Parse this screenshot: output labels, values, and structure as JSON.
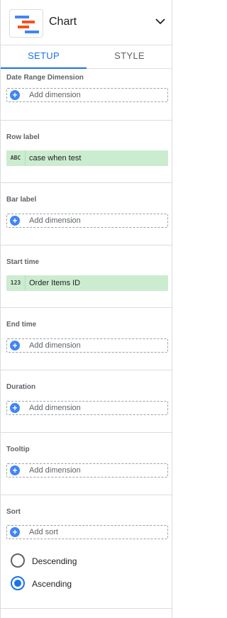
{
  "header": {
    "title": "Chart",
    "icon": "gantt-chart-icon",
    "chevron": "chevron-down-icon"
  },
  "tabs": [
    {
      "label": "SETUP",
      "active": true
    },
    {
      "label": "STYLE",
      "active": false
    }
  ],
  "sections": {
    "date_range": {
      "label": "Date Range Dimension",
      "add_label": "Add dimension"
    },
    "row_label": {
      "label": "Row label",
      "field": {
        "type": "ABC",
        "name": "case when test"
      }
    },
    "bar_label": {
      "label": "Bar label",
      "add_label": "Add dimension"
    },
    "start_time": {
      "label": "Start time",
      "field": {
        "type": "123",
        "name": "Order Items ID"
      }
    },
    "end_time": {
      "label": "End time",
      "add_label": "Add dimension"
    },
    "duration": {
      "label": "Duration",
      "add_label": "Add dimension"
    },
    "tooltip": {
      "label": "Tooltip",
      "add_label": "Add dimension"
    },
    "sort": {
      "label": "Sort",
      "add_label": "Add sort",
      "options": [
        {
          "label": "Descending",
          "selected": false
        },
        {
          "label": "Ascending",
          "selected": true
        }
      ]
    }
  },
  "colors": {
    "accent": "#1a73e8",
    "chip_green": "#ccecd0",
    "plus_blue": "#4285f4",
    "icon_orange": "#f4511e",
    "icon_blue": "#1a73e8"
  }
}
